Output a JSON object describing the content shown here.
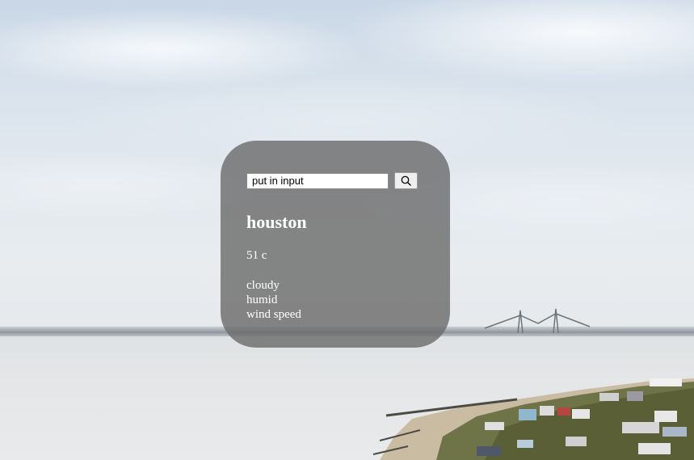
{
  "search": {
    "placeholder": "put in input",
    "button_icon": "search-icon"
  },
  "weather": {
    "city": "houston",
    "temperature": "51 c",
    "condition": "cloudy",
    "humidity": "humid",
    "wind": "wind speed"
  },
  "colors": {
    "card_background": "#6c6c6c",
    "text": "#ffffff"
  }
}
